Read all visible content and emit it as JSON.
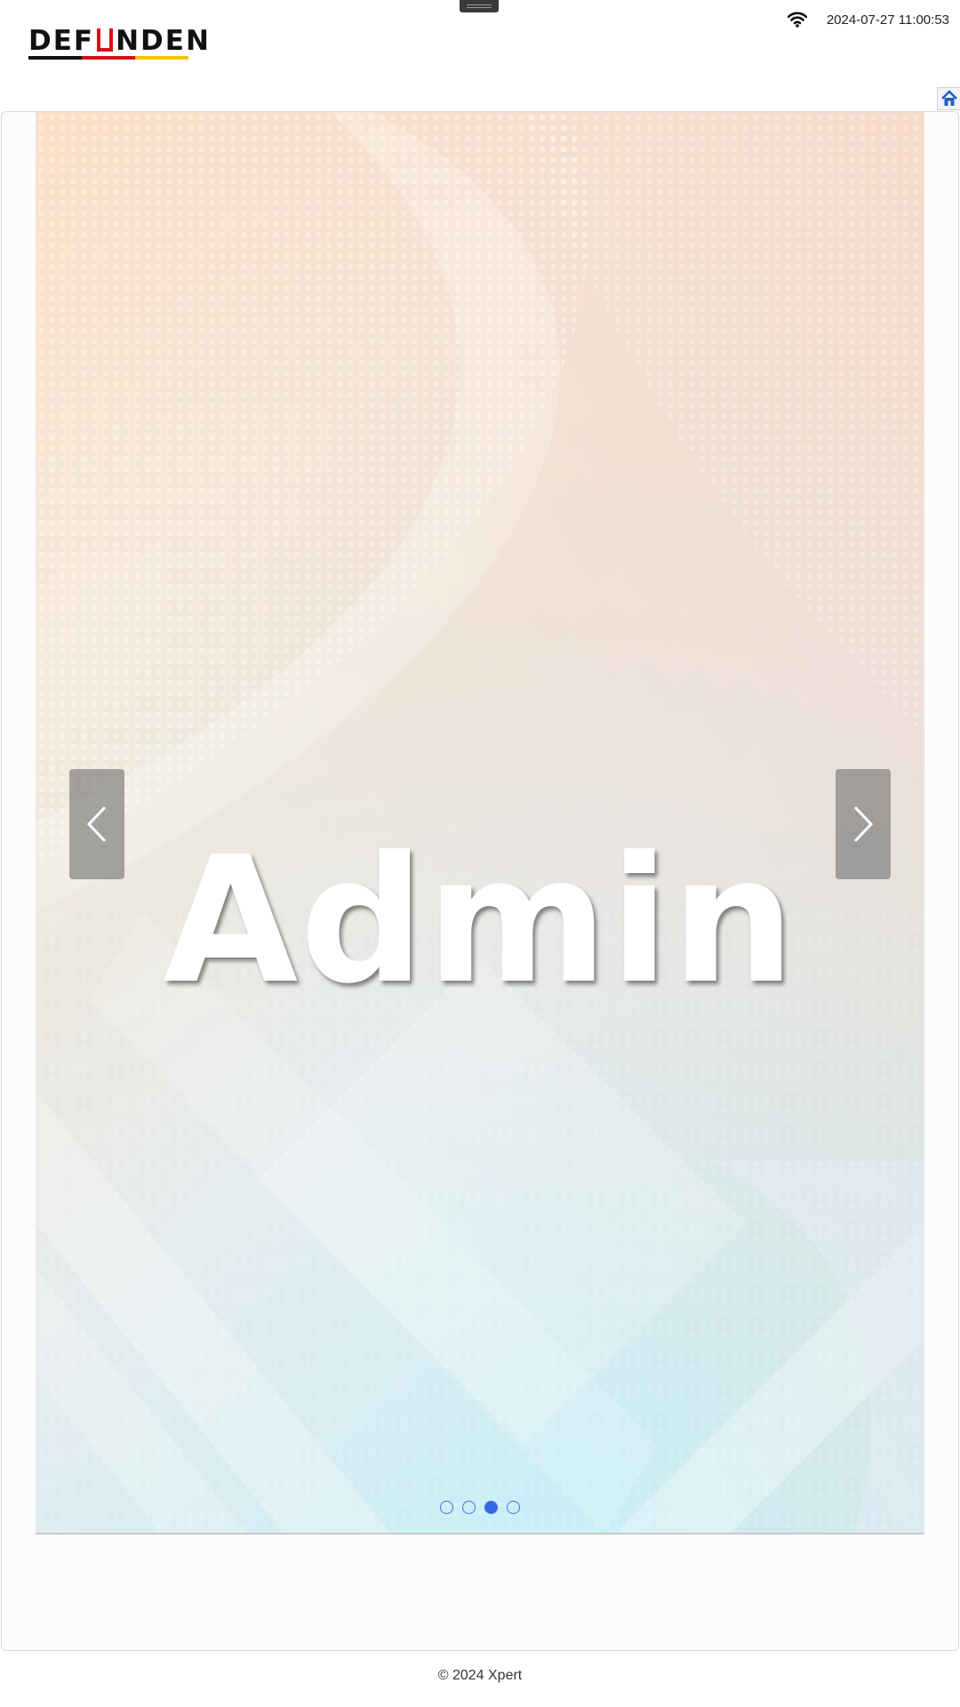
{
  "header": {
    "logo_alt": "DEFUNDEN",
    "logo_prefix": "DEF",
    "logo_suffix": "NDEN",
    "datetime": "2024-07-27 11:00:53",
    "wifi_icon": "wifi-icon",
    "home_icon": "home-icon"
  },
  "carousel": {
    "slide_title": "Admin",
    "prev_icon": "chevron-left-icon",
    "next_icon": "chevron-right-icon",
    "slide_count": 4,
    "active_index": 2
  },
  "footer": {
    "copyright": "© 2024 Xpert"
  },
  "colors": {
    "indicator_active": "#3468e6",
    "logo_red": "#d6101a",
    "logo_yellow": "#f4c300",
    "home_blue": "#1f5fbf"
  }
}
